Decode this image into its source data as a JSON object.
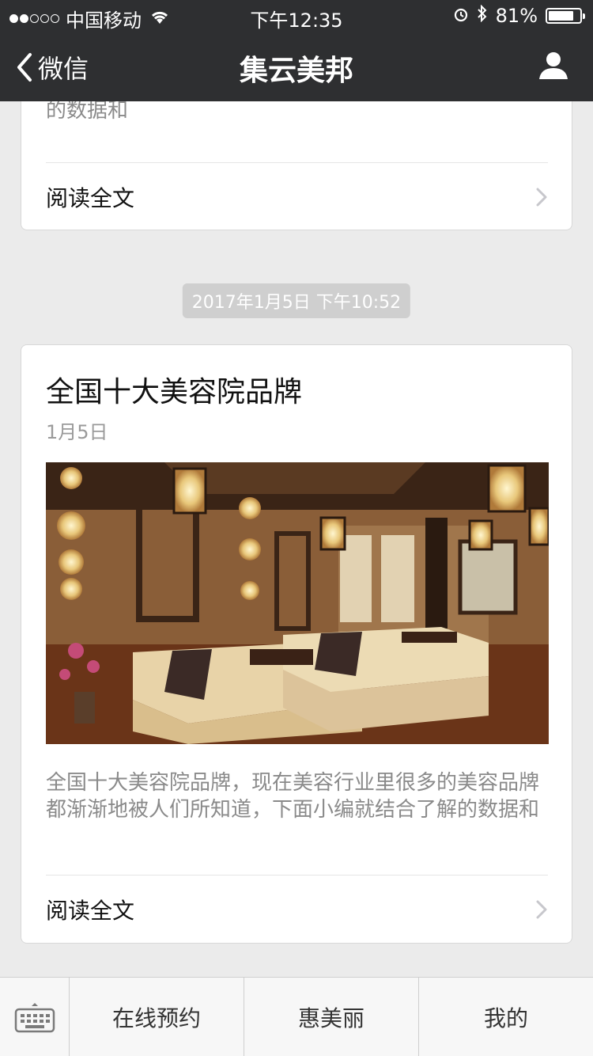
{
  "status_bar": {
    "carrier": "中国移动",
    "time": "下午12:35",
    "battery": "81%",
    "battery_level": 0.81,
    "signal_bars_filled": 2,
    "signal_bars_total": 5
  },
  "nav": {
    "back_label": "微信",
    "title": "集云美邦"
  },
  "feed": {
    "previous_card": {
      "summary_tail": "的数据和",
      "read_more": "阅读全文"
    },
    "timestamp": "2017年1月5日 下午10:52",
    "article": {
      "title": "全国十大美容院品牌",
      "date": "1月5日",
      "summary": "全国十大美容院品牌，现在美容行业里很多的美容品牌都渐渐地被人们所知道，下面小编就结合了解的数据和",
      "read_more": "阅读全文"
    }
  },
  "bottom_menu": {
    "items": [
      "在线预约",
      "惠美丽",
      "我的"
    ]
  },
  "colors": {
    "nav_background": "#2e2f31",
    "page_background": "#ebebeb"
  }
}
